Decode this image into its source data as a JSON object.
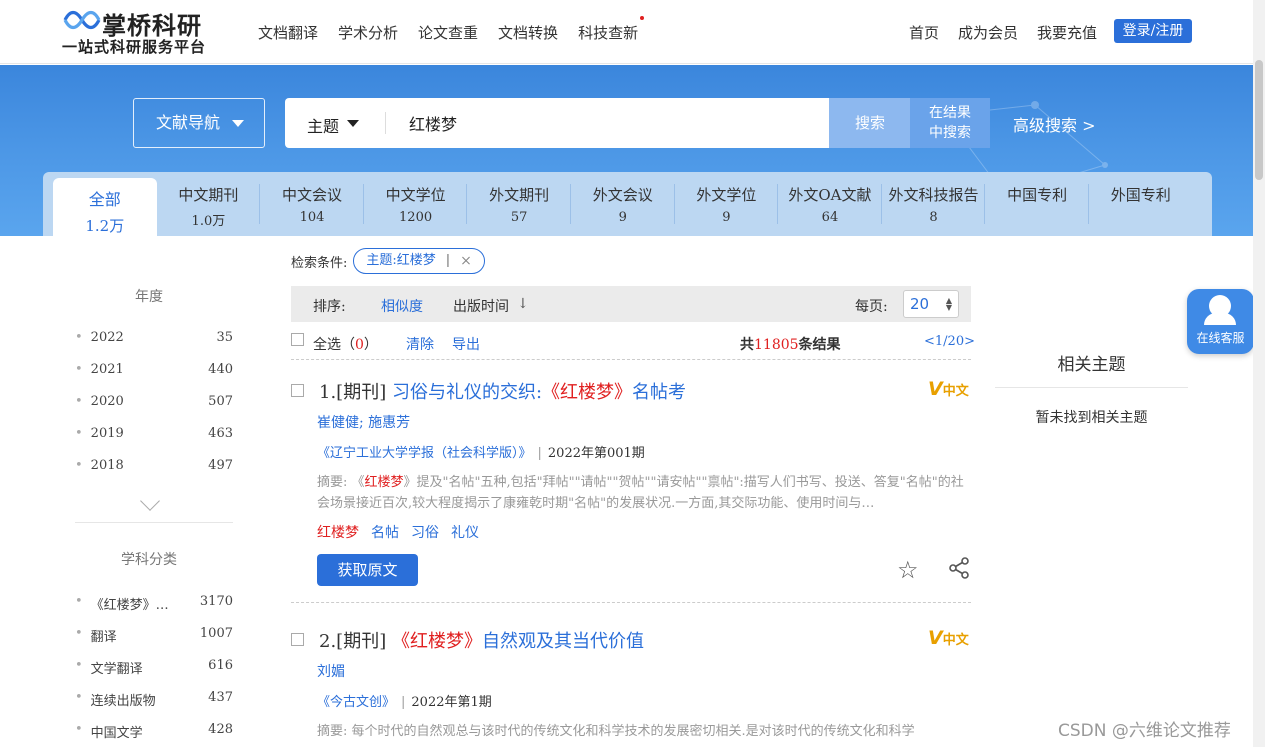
{
  "brand": {
    "name": "掌桥科研",
    "slogan": "一站式科研服务平台"
  },
  "topnav": [
    "文档翻译",
    "学术分析",
    "论文查重",
    "文档转换",
    "科技查新"
  ],
  "rightnav": [
    "首页",
    "成为会员",
    "我要充值"
  ],
  "login_label": "登录/注册",
  "search": {
    "nav_label": "文献导航",
    "field": "主题",
    "query": "红楼梦",
    "search_btn": "搜索",
    "within_btn_line1": "在结果",
    "within_btn_line2": "中搜索",
    "advanced": "高级搜索 >"
  },
  "tabs": [
    {
      "label": "全部",
      "count": "1.2万"
    },
    {
      "label": "中文期刊",
      "count": "1.0万"
    },
    {
      "label": "中文会议",
      "count": "104"
    },
    {
      "label": "中文学位",
      "count": "1200"
    },
    {
      "label": "外文期刊",
      "count": "57"
    },
    {
      "label": "外文会议",
      "count": "9"
    },
    {
      "label": "外文学位",
      "count": "9"
    },
    {
      "label": "外文OA文献",
      "count": "64"
    },
    {
      "label": "外文科技报告",
      "count": "8"
    },
    {
      "label": "中国专利",
      "count": ""
    },
    {
      "label": "外国专利",
      "count": ""
    }
  ],
  "sidebar": {
    "year_title": "年度",
    "years": [
      {
        "name": "2022",
        "count": "35"
      },
      {
        "name": "2021",
        "count": "440"
      },
      {
        "name": "2020",
        "count": "507"
      },
      {
        "name": "2019",
        "count": "463"
      },
      {
        "name": "2018",
        "count": "497"
      }
    ],
    "subject_title": "学科分类",
    "subjects": [
      {
        "name": "《红楼梦》…",
        "count": "3170"
      },
      {
        "name": "翻译",
        "count": "1007"
      },
      {
        "name": "文学翻译",
        "count": "616"
      },
      {
        "name": "连续出版物",
        "count": "437"
      },
      {
        "name": "中国文学",
        "count": "428"
      }
    ]
  },
  "condition": {
    "label": "检索条件:",
    "chip": "主题:红楼梦",
    "bar": "|",
    "close": "×"
  },
  "sort": {
    "label": "排序:",
    "relevance": "相似度",
    "date": "出版时间",
    "arrow": "↓",
    "per_page_label": "每页:",
    "per_page": "20"
  },
  "select": {
    "all": "全选（",
    "count": "0",
    "all_end": "）",
    "clear": "清除",
    "export": "导出",
    "total_pre": "共",
    "total": "11805",
    "total_post": "条结果",
    "pager": "<1/20>"
  },
  "results": [
    {
      "index": "1.[期刊]",
      "title_pre": "习俗与礼仪的交织:",
      "title_hl": "《红楼梦》",
      "title_post": "名帖考",
      "badge_v": "V",
      "badge": "中文",
      "authors": "崔健健; 施惠芳",
      "journal": "《辽宁工业大学学报（社会科学版）》",
      "sep": "|",
      "issue": "2022年第001期",
      "abs_pre": "摘要: 《",
      "abs_hl": "红楼梦",
      "abs_post": "》提及\"名帖\"五种,包括\"拜帖\"\"请帖\"\"贺帖\"\"请安帖\"\"禀帖\":描写人们书写、投送、答复\"名帖\"的社会场景接近百次,较大程度揭示了康雍乾时期\"名帖\"的发展状况.一方面,其交际功能、使用时间与…",
      "keywords": [
        "红楼梦",
        "名帖",
        "习俗",
        "礼仪"
      ],
      "get": "获取原文",
      "star": "☆"
    },
    {
      "index": "2.[期刊]",
      "title_hl": "《红楼梦》",
      "title_post": "自然观及其当代价值",
      "badge_v": "V",
      "badge": "中文",
      "authors": "刘媚",
      "journal": "《今古文创》",
      "sep": "|",
      "issue": "2022年第1期",
      "abs": "摘要: 每个时代的自然观总与该时代的传统文化和科学技术的发展密切相关.是对该时代的传统文化和科学"
    }
  ],
  "related": {
    "title": "相关主题",
    "empty": "暂未找到相关主题"
  },
  "service": "在线客服",
  "watermark": "CSDN @六维论文推荐",
  "colors": {
    "accent": "#2b6fd9",
    "highlight": "#e02020",
    "badge": "#e8a000"
  }
}
